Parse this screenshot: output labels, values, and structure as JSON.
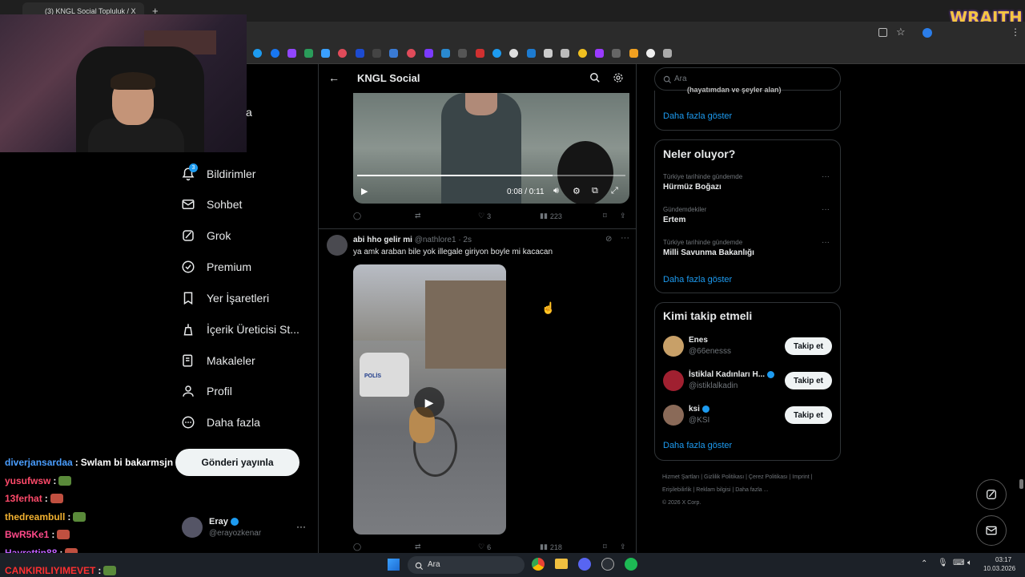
{
  "browser": {
    "tab_title": "(3) KNGL Social Topluluk / X",
    "new_tab": "+"
  },
  "overlay": {
    "brand": "WRAITH"
  },
  "nav": {
    "partial_label": "a",
    "items": [
      {
        "label": "Bildirimler",
        "icon": "bell-icon",
        "badge": "3"
      },
      {
        "label": "Sohbet",
        "icon": "mail-icon"
      },
      {
        "label": "Grok",
        "icon": "grok-icon"
      },
      {
        "label": "Premium",
        "icon": "premium-icon"
      },
      {
        "label": "Yer İşaretleri",
        "icon": "bookmark-icon"
      },
      {
        "label": "İçerik Üreticisi St...",
        "icon": "creator-studio-icon"
      },
      {
        "label": "Makaleler",
        "icon": "articles-icon"
      },
      {
        "label": "Profil",
        "icon": "profile-icon"
      },
      {
        "label": "Daha fazla",
        "icon": "more-circle-icon"
      }
    ],
    "post_button": "Gönderi yayınla",
    "account": {
      "name": "Eray",
      "handle": "@erayozkenar",
      "more": "···"
    }
  },
  "chat": [
    {
      "user": "diverjansardaa",
      "color": "#4a9eff",
      "sep": " : ",
      "msg": "Swlam bi bakarmsjn"
    },
    {
      "user": "yusufwsw",
      "color": "#ff4a6a",
      "sep": " : ",
      "msg": ""
    },
    {
      "user": "13ferhat",
      "color": "#ff4a6a",
      "sep": " : ",
      "msg": ""
    },
    {
      "user": "thedreambull",
      "color": "#f0b030",
      "sep": " : ",
      "msg": ""
    },
    {
      "user": "BwR5Ke1",
      "color": "#ff4a8a",
      "sep": " : ",
      "msg": ""
    },
    {
      "user": "Hayrettin88",
      "color": "#c060ff",
      "sep": " : ",
      "msg": ""
    },
    {
      "user": "CANKIRILIYIMEVET",
      "color": "#ff3030",
      "sep": " : ",
      "msg": ""
    }
  ],
  "main": {
    "header_title": "KNGL Social",
    "video": {
      "time": "0:08 / 0:11"
    },
    "post1_actions": {
      "likes": "3",
      "views": "223"
    },
    "post2": {
      "author": "abi hho gelir mi",
      "handle": "@nathlore1",
      "time": "· 2s",
      "text": "ya amk araban bile yok illegale giriyon boyle mi kacacan",
      "image_text": "POLİS"
    },
    "post2_actions": {
      "likes": "6",
      "views": "218"
    }
  },
  "right": {
    "search_placeholder": "Ara",
    "partial_text": "(hayatımdan ve şeyler alan)",
    "show_more": "Daha fazla göster",
    "trends_title": "Neler oluyor?",
    "trends": [
      {
        "context": "Türkiye tarihinde gündemde",
        "name": "Hürmüz Boğazı"
      },
      {
        "context": "Gündemdekiler",
        "name": "Ertem"
      },
      {
        "context": "Türkiye tarihinde gündemde",
        "name": "Milli Savunma Bakanlığı"
      }
    ],
    "who_to_follow_title": "Kimi takip etmeli",
    "suggestions": [
      {
        "name": "Enes",
        "handle": "@66enesss",
        "verified": false,
        "button": "Takip et"
      },
      {
        "name": "İstiklal Kadınları H...",
        "handle": "@istiklalkadin",
        "verified": true,
        "button": "Takip et"
      },
      {
        "name": "ksi",
        "handle": "@KSI",
        "verified": true,
        "button": "Takip et"
      }
    ],
    "footer": [
      "Hizmet Şartları",
      "Gizlilik Politikası",
      "Çerez Politikası",
      "Imprint",
      "Erişilebilirlik",
      "Reklam bilgisi",
      "Daha fazla ...",
      "© 2026 X Corp."
    ]
  },
  "taskbar": {
    "search": "Ara",
    "time": "03:17",
    "date": "10.03.2026"
  },
  "colors": {
    "accent": "#1d9bf0",
    "bg": "#000000",
    "border": "#2f3336"
  }
}
